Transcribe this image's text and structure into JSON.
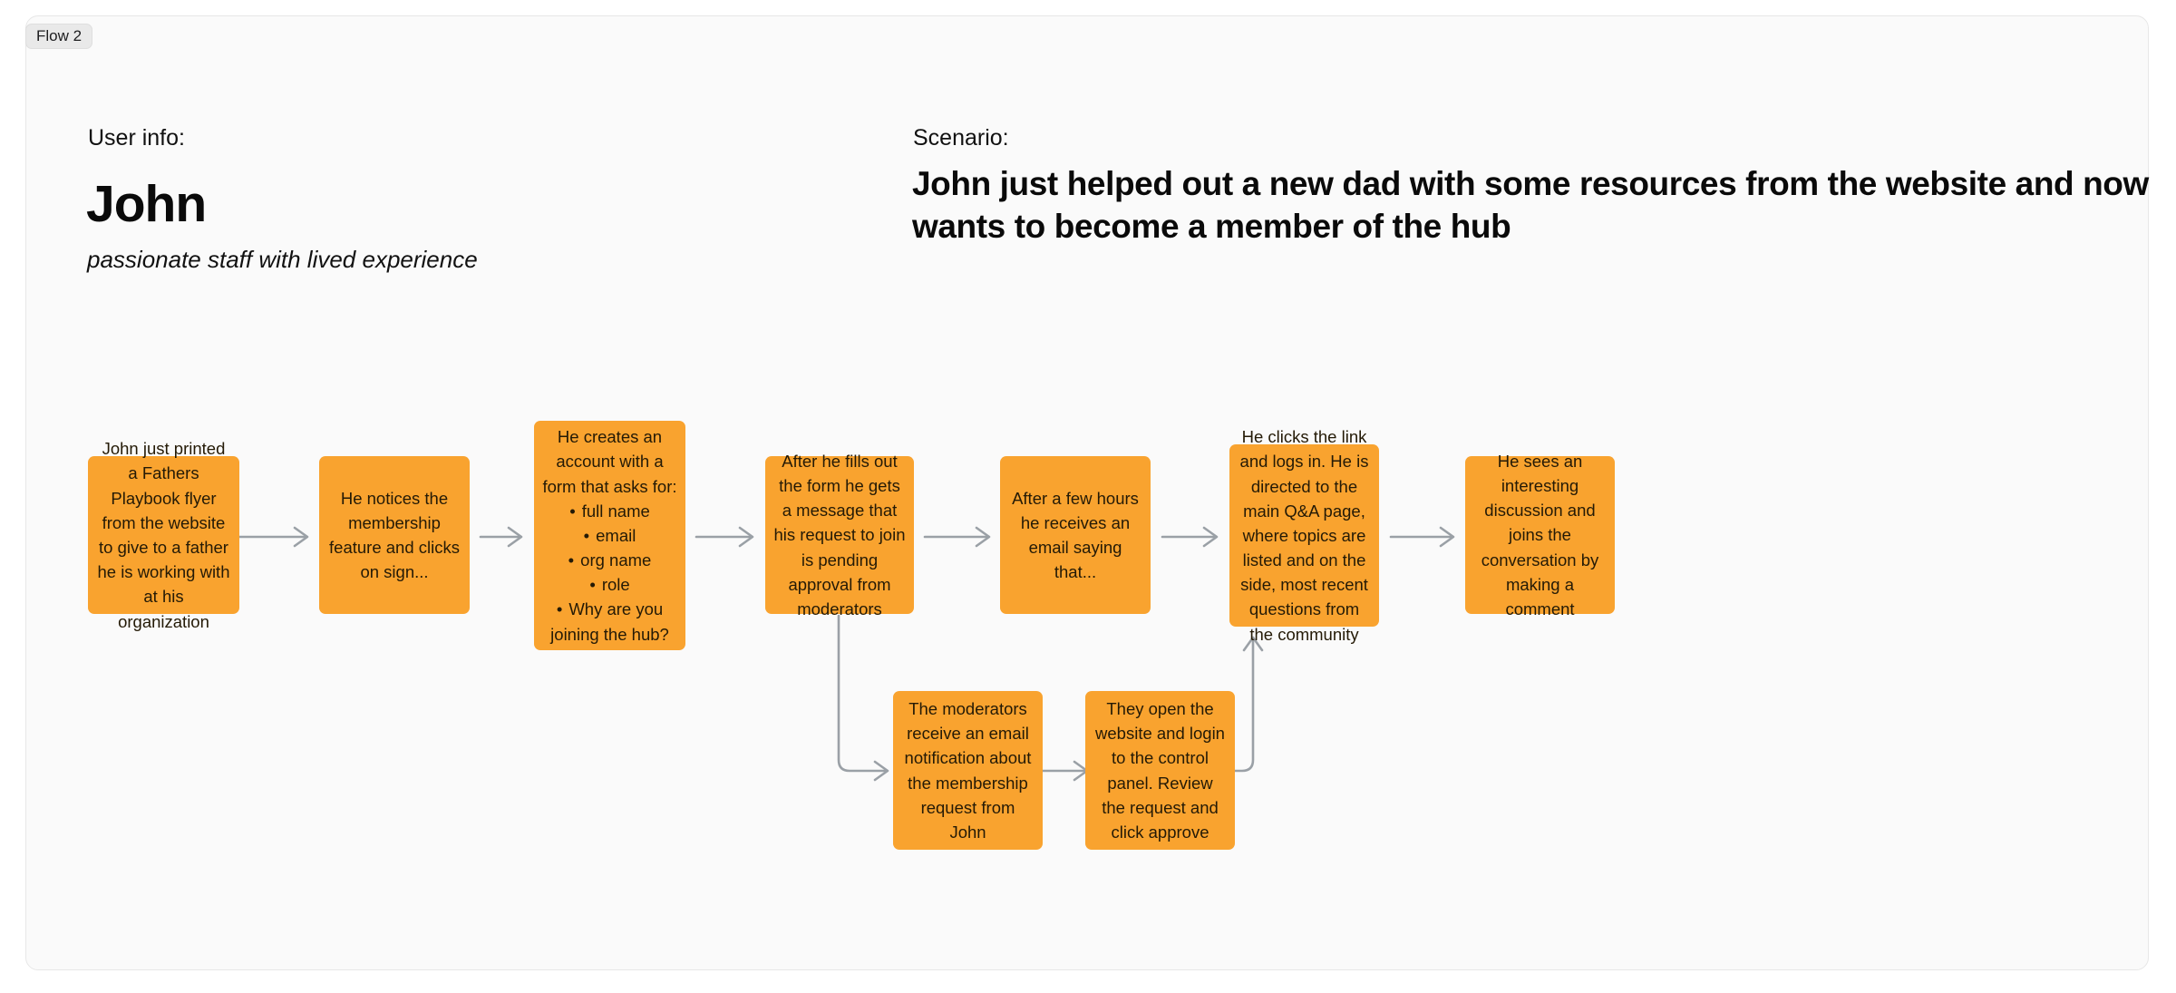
{
  "frame": {
    "badge_label": "Flow 2"
  },
  "header": {
    "user_info_label": "User info:",
    "user_name": "John",
    "user_subtitle": "passionate staff with lived experience",
    "scenario_label": "Scenario:",
    "scenario_text": "John just helped out a new dad with some resources from the website and now wants to become a member of the hub"
  },
  "colors": {
    "node_fill": "#F9A32F",
    "node_text": "#241A06",
    "connector": "#9AA0A6",
    "canvas": "#FAFAFA",
    "badge": "#E9E9E9"
  },
  "nodes": [
    {
      "id": "n1",
      "text": "John just printed a Fathers Playbook flyer from the website to give to a father he is working with at his organization"
    },
    {
      "id": "n2",
      "text": "He notices the membership feature and clicks on sign..."
    },
    {
      "id": "n3",
      "lead": "He creates an account with a form that asks for:",
      "bullets": [
        "full name",
        "email",
        "org name",
        "role",
        "Why are you joining the hub?"
      ]
    },
    {
      "id": "n4",
      "text": "After he fills out the form he gets a message that his request to join is pending approval from moderators"
    },
    {
      "id": "n5",
      "text": "After a few hours he receives an email saying that..."
    },
    {
      "id": "n6",
      "text": "He clicks the link and logs in. He is directed to the main Q&A page, where topics are listed and on the side, most recent questions from the community"
    },
    {
      "id": "n7",
      "text": "He sees an interesting discussion and joins the conversation by making a comment"
    },
    {
      "id": "n8",
      "text": "The moderators receive an email notification about the membership request from John"
    },
    {
      "id": "n9",
      "text": "They open the website and login to the control panel. Review the request and click approve"
    }
  ]
}
